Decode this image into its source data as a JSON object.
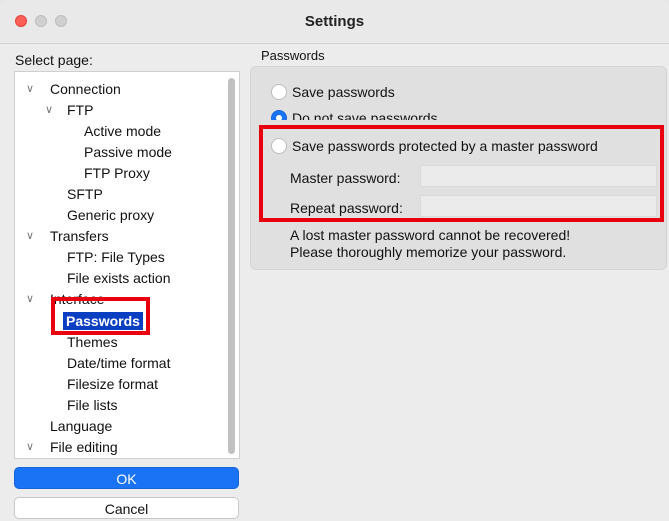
{
  "window": {
    "title": "Settings"
  },
  "left": {
    "select_page_label": "Select page:",
    "tree": [
      {
        "label": "Connection",
        "chevron": true
      },
      {
        "label": "FTP",
        "chevron": true
      },
      {
        "label": "Active mode"
      },
      {
        "label": "Passive mode"
      },
      {
        "label": "FTP Proxy"
      },
      {
        "label": "SFTP"
      },
      {
        "label": "Generic proxy"
      },
      {
        "label": "Transfers",
        "chevron": true
      },
      {
        "label": "FTP: File Types"
      },
      {
        "label": "File exists action"
      },
      {
        "label": "Interface",
        "chevron": true
      },
      {
        "label": "Passwords",
        "selected": true
      },
      {
        "label": "Themes"
      },
      {
        "label": "Date/time format"
      },
      {
        "label": "Filesize format"
      },
      {
        "label": "File lists"
      },
      {
        "label": "Language"
      },
      {
        "label": "File editing",
        "chevron": true
      }
    ],
    "ok_label": "OK",
    "cancel_label": "Cancel"
  },
  "right": {
    "section_title": "Passwords",
    "options": [
      {
        "label": "Save passwords",
        "checked": false
      },
      {
        "label": "Do not save passwords",
        "checked": true
      },
      {
        "label": "Save passwords protected by a master password",
        "checked": false
      }
    ],
    "master_password_label": "Master password:",
    "master_password_value": "",
    "repeat_password_label": "Repeat password:",
    "repeat_password_value": "",
    "note_line1": "A lost master password cannot be recovered!",
    "note_line2": "Please thoroughly memorize your password."
  },
  "colors": {
    "accent": "#1a73f5",
    "selection": "#0b3fc1",
    "highlight": "#e8000f",
    "close_button": "#fe5f57"
  }
}
